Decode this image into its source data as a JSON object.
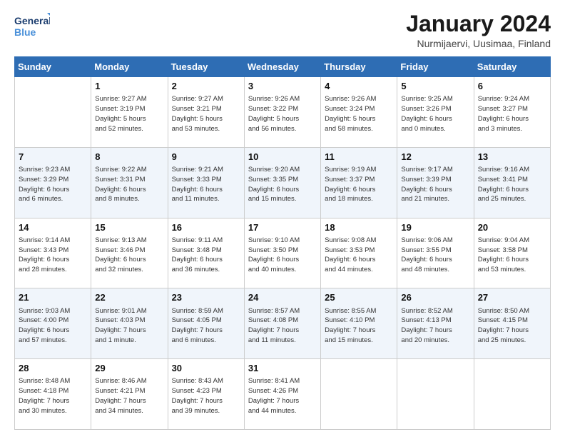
{
  "header": {
    "logo_line1": "General",
    "logo_line2": "Blue",
    "title": "January 2024",
    "subtitle": "Nurmijaervi, Uusimaa, Finland"
  },
  "days_of_week": [
    "Sunday",
    "Monday",
    "Tuesday",
    "Wednesday",
    "Thursday",
    "Friday",
    "Saturday"
  ],
  "weeks": [
    [
      {
        "day": "",
        "info": ""
      },
      {
        "day": "1",
        "info": "Sunrise: 9:27 AM\nSunset: 3:19 PM\nDaylight: 5 hours\nand 52 minutes."
      },
      {
        "day": "2",
        "info": "Sunrise: 9:27 AM\nSunset: 3:21 PM\nDaylight: 5 hours\nand 53 minutes."
      },
      {
        "day": "3",
        "info": "Sunrise: 9:26 AM\nSunset: 3:22 PM\nDaylight: 5 hours\nand 56 minutes."
      },
      {
        "day": "4",
        "info": "Sunrise: 9:26 AM\nSunset: 3:24 PM\nDaylight: 5 hours\nand 58 minutes."
      },
      {
        "day": "5",
        "info": "Sunrise: 9:25 AM\nSunset: 3:26 PM\nDaylight: 6 hours\nand 0 minutes."
      },
      {
        "day": "6",
        "info": "Sunrise: 9:24 AM\nSunset: 3:27 PM\nDaylight: 6 hours\nand 3 minutes."
      }
    ],
    [
      {
        "day": "7",
        "info": "Sunrise: 9:23 AM\nSunset: 3:29 PM\nDaylight: 6 hours\nand 6 minutes."
      },
      {
        "day": "8",
        "info": "Sunrise: 9:22 AM\nSunset: 3:31 PM\nDaylight: 6 hours\nand 8 minutes."
      },
      {
        "day": "9",
        "info": "Sunrise: 9:21 AM\nSunset: 3:33 PM\nDaylight: 6 hours\nand 11 minutes."
      },
      {
        "day": "10",
        "info": "Sunrise: 9:20 AM\nSunset: 3:35 PM\nDaylight: 6 hours\nand 15 minutes."
      },
      {
        "day": "11",
        "info": "Sunrise: 9:19 AM\nSunset: 3:37 PM\nDaylight: 6 hours\nand 18 minutes."
      },
      {
        "day": "12",
        "info": "Sunrise: 9:17 AM\nSunset: 3:39 PM\nDaylight: 6 hours\nand 21 minutes."
      },
      {
        "day": "13",
        "info": "Sunrise: 9:16 AM\nSunset: 3:41 PM\nDaylight: 6 hours\nand 25 minutes."
      }
    ],
    [
      {
        "day": "14",
        "info": "Sunrise: 9:14 AM\nSunset: 3:43 PM\nDaylight: 6 hours\nand 28 minutes."
      },
      {
        "day": "15",
        "info": "Sunrise: 9:13 AM\nSunset: 3:46 PM\nDaylight: 6 hours\nand 32 minutes."
      },
      {
        "day": "16",
        "info": "Sunrise: 9:11 AM\nSunset: 3:48 PM\nDaylight: 6 hours\nand 36 minutes."
      },
      {
        "day": "17",
        "info": "Sunrise: 9:10 AM\nSunset: 3:50 PM\nDaylight: 6 hours\nand 40 minutes."
      },
      {
        "day": "18",
        "info": "Sunrise: 9:08 AM\nSunset: 3:53 PM\nDaylight: 6 hours\nand 44 minutes."
      },
      {
        "day": "19",
        "info": "Sunrise: 9:06 AM\nSunset: 3:55 PM\nDaylight: 6 hours\nand 48 minutes."
      },
      {
        "day": "20",
        "info": "Sunrise: 9:04 AM\nSunset: 3:58 PM\nDaylight: 6 hours\nand 53 minutes."
      }
    ],
    [
      {
        "day": "21",
        "info": "Sunrise: 9:03 AM\nSunset: 4:00 PM\nDaylight: 6 hours\nand 57 minutes."
      },
      {
        "day": "22",
        "info": "Sunrise: 9:01 AM\nSunset: 4:03 PM\nDaylight: 7 hours\nand 1 minute."
      },
      {
        "day": "23",
        "info": "Sunrise: 8:59 AM\nSunset: 4:05 PM\nDaylight: 7 hours\nand 6 minutes."
      },
      {
        "day": "24",
        "info": "Sunrise: 8:57 AM\nSunset: 4:08 PM\nDaylight: 7 hours\nand 11 minutes."
      },
      {
        "day": "25",
        "info": "Sunrise: 8:55 AM\nSunset: 4:10 PM\nDaylight: 7 hours\nand 15 minutes."
      },
      {
        "day": "26",
        "info": "Sunrise: 8:52 AM\nSunset: 4:13 PM\nDaylight: 7 hours\nand 20 minutes."
      },
      {
        "day": "27",
        "info": "Sunrise: 8:50 AM\nSunset: 4:15 PM\nDaylight: 7 hours\nand 25 minutes."
      }
    ],
    [
      {
        "day": "28",
        "info": "Sunrise: 8:48 AM\nSunset: 4:18 PM\nDaylight: 7 hours\nand 30 minutes."
      },
      {
        "day": "29",
        "info": "Sunrise: 8:46 AM\nSunset: 4:21 PM\nDaylight: 7 hours\nand 34 minutes."
      },
      {
        "day": "30",
        "info": "Sunrise: 8:43 AM\nSunset: 4:23 PM\nDaylight: 7 hours\nand 39 minutes."
      },
      {
        "day": "31",
        "info": "Sunrise: 8:41 AM\nSunset: 4:26 PM\nDaylight: 7 hours\nand 44 minutes."
      },
      {
        "day": "",
        "info": ""
      },
      {
        "day": "",
        "info": ""
      },
      {
        "day": "",
        "info": ""
      }
    ]
  ]
}
